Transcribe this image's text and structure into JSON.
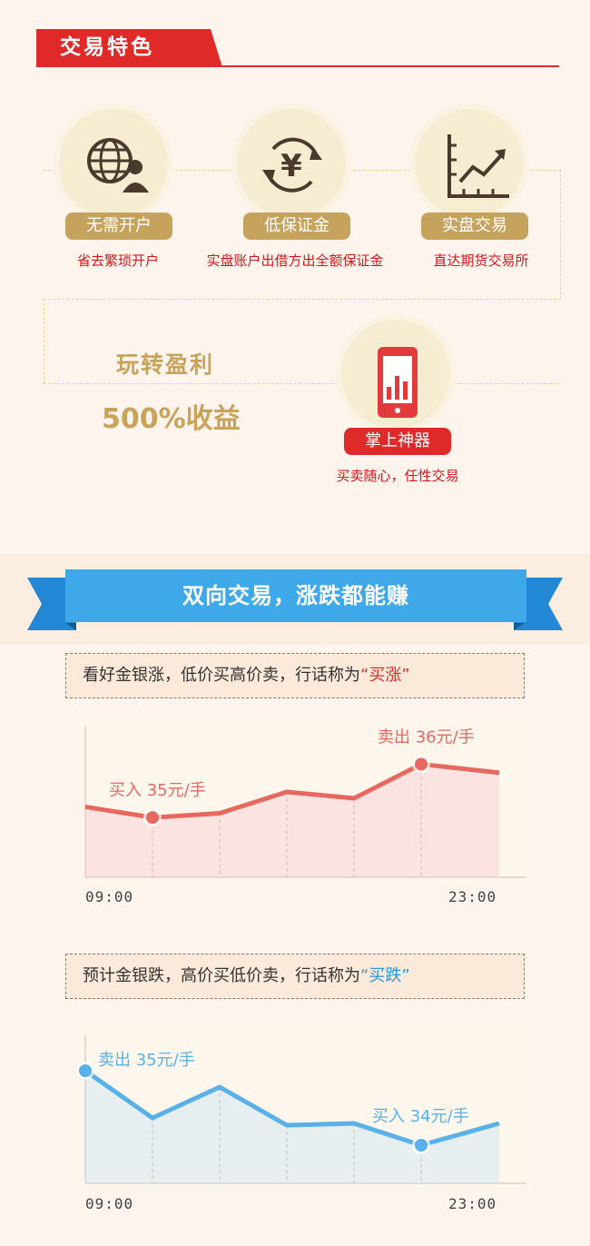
{
  "header": {
    "title": "交易特色"
  },
  "features": [
    {
      "icon": "globe-user-icon",
      "label": "无需开户",
      "desc": "省去繁琐开户"
    },
    {
      "icon": "yen-exchange-icon",
      "label": "低保证金",
      "desc": "实盘账户出借方出全额保证金"
    },
    {
      "icon": "rising-chart-icon",
      "label": "实盘交易",
      "desc": "直达期货交易所"
    },
    {
      "icon": "mobile-chart-icon",
      "label": "掌上神器",
      "desc": "买卖随心，任性交易"
    }
  ],
  "profit": {
    "line1": "玩转盈利",
    "line2": "500%收益"
  },
  "banner": {
    "title": "双向交易，涨跌都能赚"
  },
  "long_box": {
    "text": "看好金银涨，低价买高价卖，行话称为",
    "quote": "“买涨”"
  },
  "short_box": {
    "text": "预计金银跌，高价买低价卖，行话称为",
    "quote": "“买跌”"
  },
  "colors": {
    "red": "#e02a2a",
    "gold": "#c9a35a",
    "blue": "#3fa8e8"
  },
  "chart_data": [
    {
      "type": "line",
      "series": [
        {
          "values": [
            33,
            28,
            30,
            40,
            37,
            53,
            49
          ]
        }
      ],
      "x_start_label": "09:00",
      "x_end_label": "23:00",
      "annotations": [
        {
          "index": 1,
          "text": "买入 35元/手"
        },
        {
          "index": 5,
          "text": "卖出 36元/手"
        }
      ],
      "color": "#e7685f"
    },
    {
      "type": "line",
      "series": [
        {
          "values": [
            62,
            36,
            53,
            32,
            33,
            21,
            33
          ]
        }
      ],
      "x_start_label": "09:00",
      "x_end_label": "23:00",
      "annotations": [
        {
          "index": 0,
          "text": "卖出 35元/手"
        },
        {
          "index": 5,
          "text": "买入 34元/手"
        }
      ],
      "color": "#5ab0e8"
    }
  ]
}
